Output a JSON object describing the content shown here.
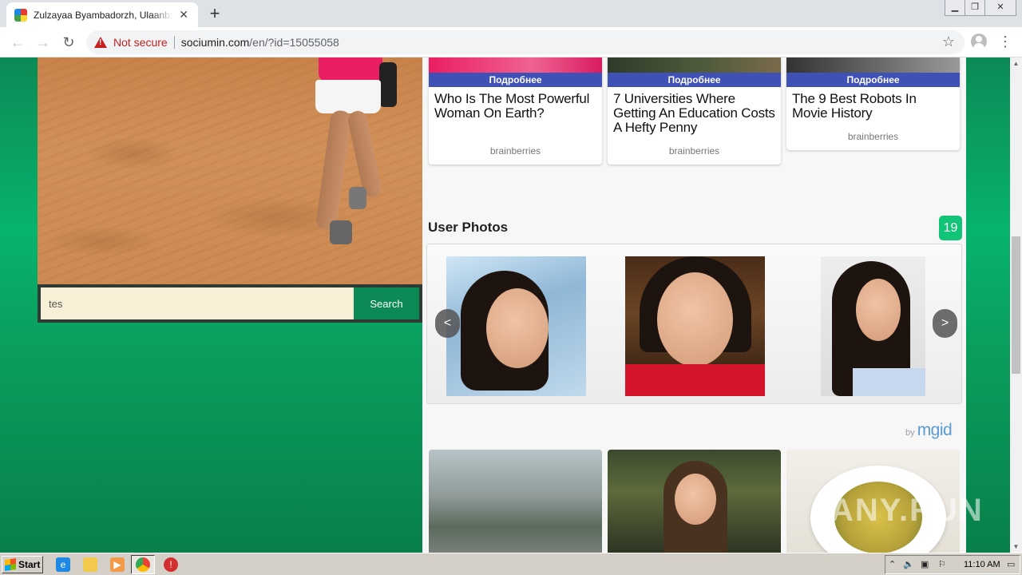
{
  "browser": {
    "tab_title": "Zulzayaa Byambadorzh, Ulaanbaatar",
    "not_secure_label": "Not secure",
    "url_domain": "sociumin.com",
    "url_path": "/en/?id=15055058"
  },
  "cards": [
    {
      "more": "Подробнее",
      "title": "Who Is The Most Powerful Woman On Earth?",
      "source": "brainberries"
    },
    {
      "more": "Подробнее",
      "title": "7 Universities Where Getting An Education Costs A Hefty Penny",
      "source": "brainberries"
    },
    {
      "more": "Подробнее",
      "title": "The 9 Best Robots In Movie History",
      "source": "brainberries"
    }
  ],
  "search": {
    "value": "tes",
    "button_label": "Search"
  },
  "user_photos": {
    "title": "User Photos",
    "count": "19",
    "prev_label": "<",
    "next_label": ">"
  },
  "ads": {
    "by_label": "by",
    "brand": "mgid"
  },
  "watermark": "ANY.RUN",
  "taskbar": {
    "start_label": "Start",
    "clock": "11:10 AM"
  }
}
